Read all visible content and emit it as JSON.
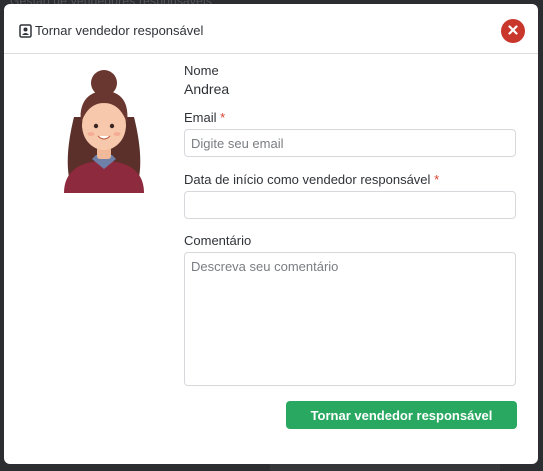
{
  "backdrop": {
    "top_text": "Gestão de vendedores responsáveis"
  },
  "modal": {
    "title": "Tornar vendedor responsável",
    "header_icon": "contact-card-icon",
    "close_icon": "close-icon",
    "colors": {
      "close": "#c9372c",
      "submit": "#28a860",
      "required": "#d9432f"
    }
  },
  "form": {
    "name_label": "Nome",
    "name_value": "Andrea",
    "email_label": "Email",
    "email_placeholder": "Digite seu email",
    "start_date_label": "Data de início como vendedor responsável",
    "start_date_value": "",
    "comment_label": "Comentário",
    "comment_placeholder": "Descreva seu comentário",
    "required_marker": "*",
    "submit_label": "Tornar vendedor responsável"
  }
}
